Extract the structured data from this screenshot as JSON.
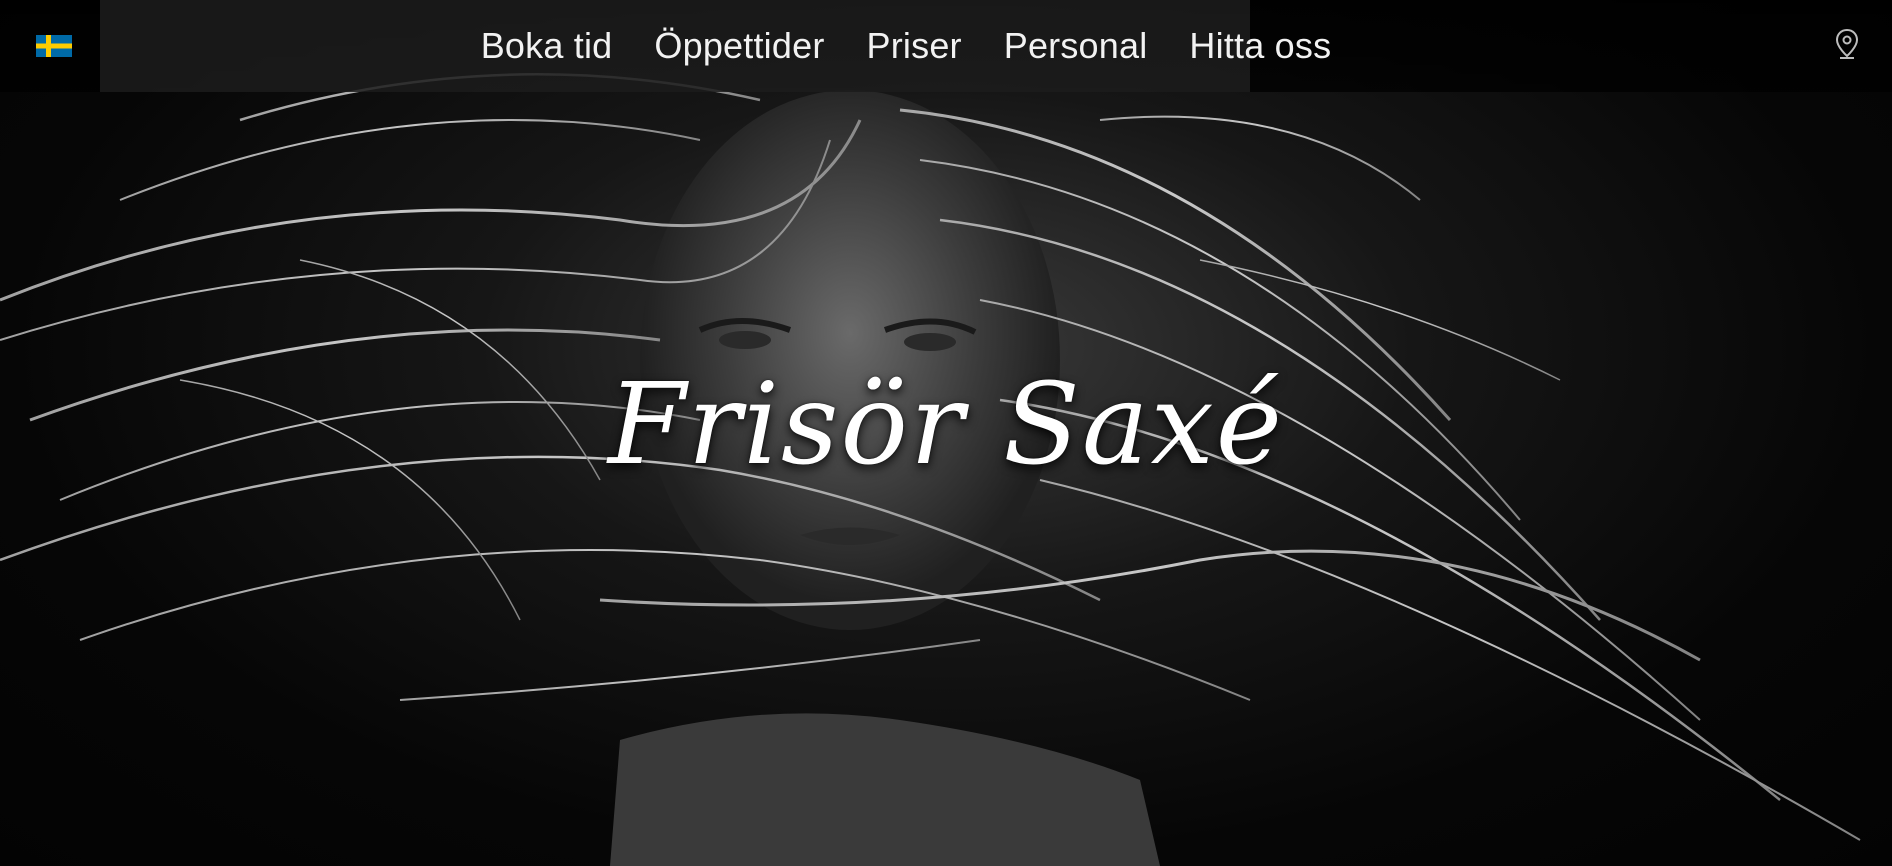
{
  "header": {
    "language_flag": "sweden-flag-icon",
    "nav": [
      {
        "label": "Boka tid"
      },
      {
        "label": "Öppettider"
      },
      {
        "label": "Priser"
      },
      {
        "label": "Personal"
      },
      {
        "label": "Hitta oss"
      }
    ],
    "location_icon": "map-pin-icon"
  },
  "hero": {
    "title": "Frisör Saxé",
    "image": "black-and-white portrait photo",
    "colors": {
      "flag_blue": "#006AA7",
      "flag_yellow": "#FECC00",
      "text": "#FFFFFF",
      "background": "#050505"
    }
  }
}
